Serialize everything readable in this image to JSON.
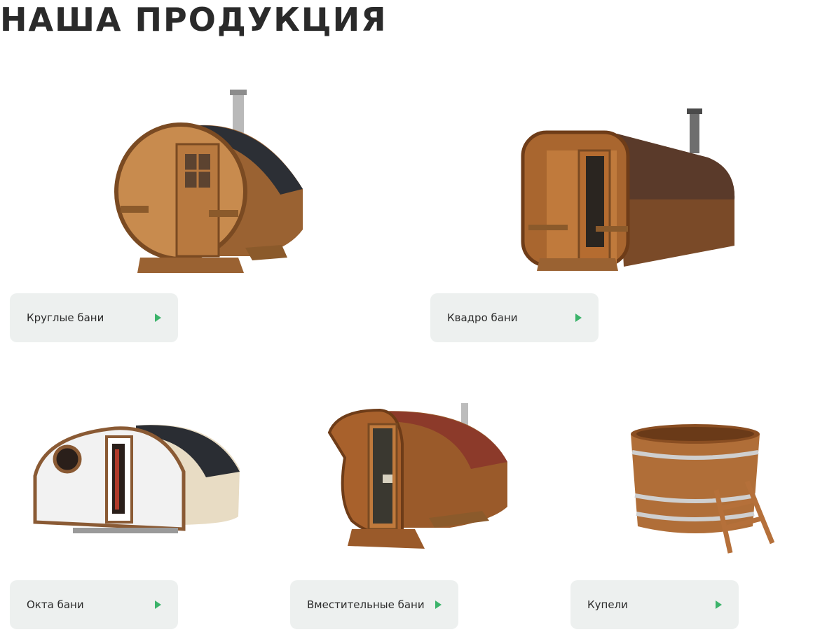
{
  "page": {
    "title": "НАША ПРОДУКЦИЯ"
  },
  "colors": {
    "accent": "#3bb36a",
    "card_bg": "#edf0ef"
  },
  "products": [
    {
      "label": "Круглые бани",
      "icon": "arrow-right-icon"
    },
    {
      "label": "Квадро бани",
      "icon": "arrow-right-icon"
    },
    {
      "label": "Окта бани",
      "icon": "arrow-right-icon"
    },
    {
      "label": "Вместительные бани",
      "icon": "arrow-right-icon"
    },
    {
      "label": "Купели",
      "icon": "arrow-right-icon"
    }
  ]
}
